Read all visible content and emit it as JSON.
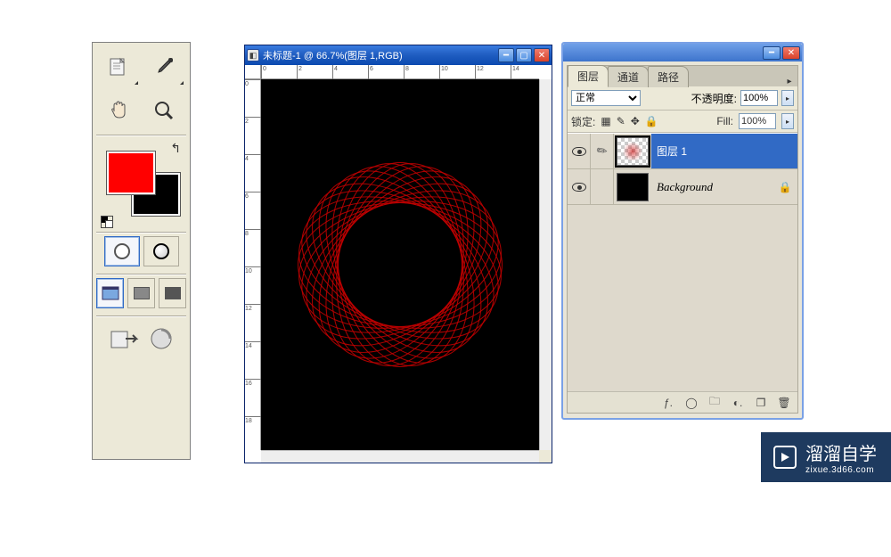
{
  "colors": {
    "foreground": "#ff0000",
    "background": "#000000"
  },
  "toolbox": {
    "tools": [
      [
        "notes-tool",
        "eyedropper-tool"
      ],
      [
        "hand-tool",
        "zoom-tool"
      ]
    ]
  },
  "document": {
    "title": "未标题-1 @ 66.7%(图层 1,RGB)",
    "ruler_h_ticks": [
      "0",
      "2",
      "4",
      "6",
      "8",
      "10",
      "12",
      "14"
    ],
    "ruler_v_ticks": [
      "0",
      "2",
      "4",
      "6",
      "8",
      "10",
      "12",
      "14",
      "16",
      "18"
    ]
  },
  "palette": {
    "tabs": {
      "layers": "图层",
      "channels": "通道",
      "paths": "路径"
    },
    "blend_mode": "正常",
    "opacity_label": "不透明度:",
    "opacity_value": "100%",
    "lock_label": "锁定:",
    "fill_label": "Fill:",
    "fill_value": "100%",
    "layers": [
      {
        "name": "图层 1",
        "selected": true,
        "thumb": "checker",
        "link_icon": "brush"
      },
      {
        "name": "Background",
        "selected": false,
        "thumb": "black",
        "locked": true,
        "italic": true
      }
    ]
  },
  "watermark": {
    "text": "溜溜自学",
    "url": "zixue.3d66.com"
  }
}
